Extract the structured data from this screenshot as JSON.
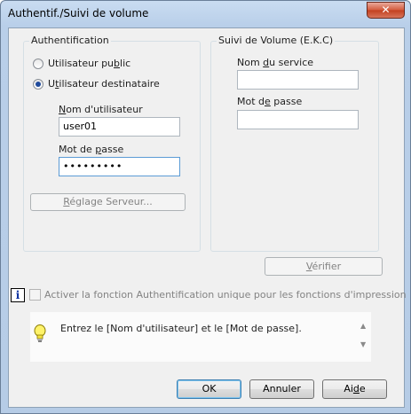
{
  "window": {
    "title": "Authentif./Suivi de volume",
    "close_glyph": "✕"
  },
  "auth_group": {
    "label": "Authentification",
    "radio_public": {
      "label_pre": "Utilisateur pu",
      "label_u": "b",
      "label_post": "lic",
      "checked": false
    },
    "radio_dest": {
      "label_pre": "U",
      "label_u": "t",
      "label_post": "ilisateur destinataire",
      "checked": true
    },
    "username": {
      "label_u": "N",
      "label_post": "om d'utilisateur",
      "value": "user01"
    },
    "password": {
      "label_pre": "Mot de ",
      "label_u": "p",
      "label_post": "asse",
      "value": "•••••••••"
    },
    "server_button": {
      "label_u": "R",
      "label_post": "églage Serveur..."
    }
  },
  "volume_group": {
    "label": "Suivi de Volume (E.K.C)",
    "service": {
      "label_pre": "Nom ",
      "label_u": "d",
      "label_post": "u service",
      "value": ""
    },
    "password": {
      "label_pre": "Mot d",
      "label_u": "e",
      "label_post": " passe",
      "value": ""
    },
    "verify_button": {
      "label_u": "V",
      "label_post": "érifier"
    }
  },
  "single_auth": {
    "info_glyph": "i",
    "checkbox_label": "Activer la fonction Authentification unique pour les fonctions d'impression",
    "checked": false
  },
  "help": {
    "icon": "lightbulb-icon",
    "text": "Entrez le [Nom d'utilisateur] et le [Mot de passe].",
    "scroll_up": "▲",
    "scroll_down": "▼"
  },
  "buttons": {
    "ok": "OK",
    "cancel": "Annuler",
    "help_pre": "Ai",
    "help_u": "d",
    "help_post": "e"
  }
}
